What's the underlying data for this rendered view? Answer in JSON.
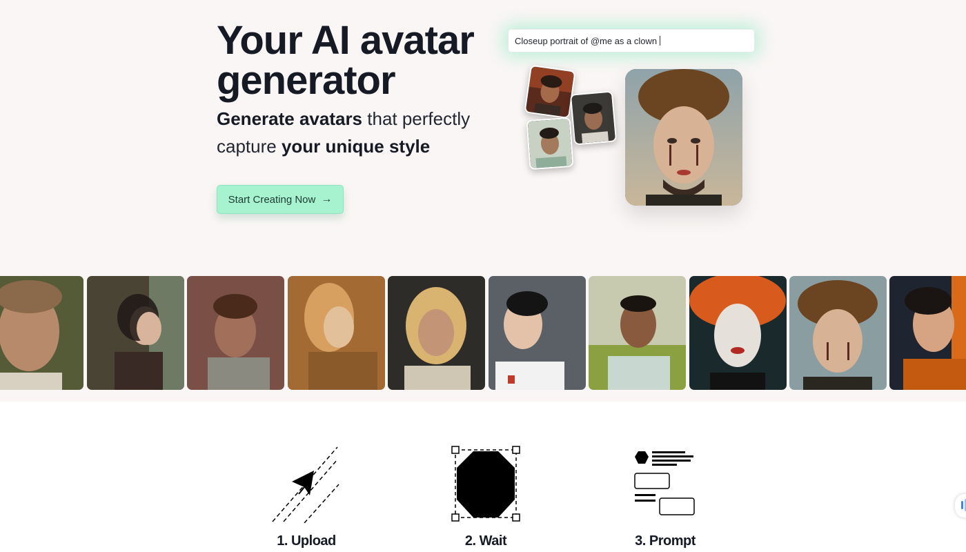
{
  "hero": {
    "title_line1": "Your AI avatar",
    "title_line2": "generator",
    "subtitle_bold1": "Generate avatars",
    "subtitle_text1": " that perfectly capture ",
    "subtitle_bold2": "your unique style",
    "cta_label": "Start Creating Now",
    "cta_icon": "arrow-right-icon",
    "prompt_text": "Closeup portrait of @me as a clown"
  },
  "gallery": {
    "count": 10
  },
  "steps": [
    {
      "label": "1. Upload",
      "icon": "upload-paper-plane-icon"
    },
    {
      "label": "2. Wait",
      "icon": "octagon-selection-icon"
    },
    {
      "label": "3. Prompt",
      "icon": "prompt-form-icon"
    }
  ],
  "colors": {
    "accent": "#a7f3d0",
    "background": "#faf6f5",
    "text": "#161a24"
  }
}
